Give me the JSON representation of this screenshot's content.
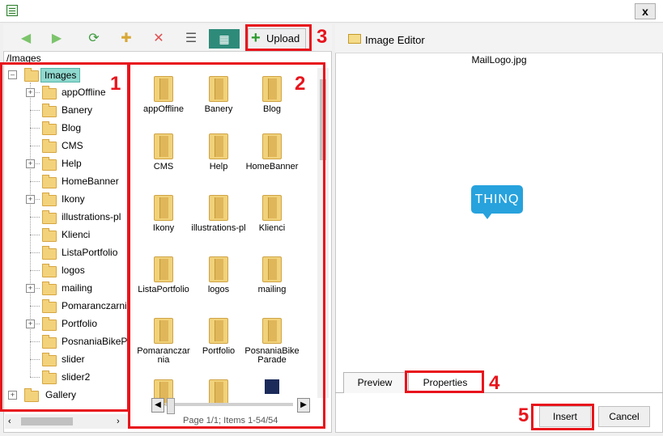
{
  "window": {
    "close_label": "x"
  },
  "toolbar": {
    "back_icon": "arrow-left-icon",
    "forward_icon": "arrow-right-icon",
    "refresh_icon": "refresh-icon",
    "new_folder_icon": "new-folder-icon",
    "delete_icon": "delete-icon",
    "list_view_icon": "list-view-icon",
    "thumb_view_icon": "thumbnail-view-icon",
    "upload_label": "Upload"
  },
  "path": "/Images",
  "tree": {
    "root": "Images",
    "items": [
      {
        "label": "appOffline",
        "expandable": true
      },
      {
        "label": "Banery",
        "expandable": false
      },
      {
        "label": "Blog",
        "expandable": false
      },
      {
        "label": "CMS",
        "expandable": false
      },
      {
        "label": "Help",
        "expandable": true
      },
      {
        "label": "HomeBanner",
        "expandable": false
      },
      {
        "label": "Ikony",
        "expandable": true
      },
      {
        "label": "illustrations-pl",
        "expandable": false
      },
      {
        "label": "Klienci",
        "expandable": false
      },
      {
        "label": "ListaPortfolio",
        "expandable": false
      },
      {
        "label": "logos",
        "expandable": false
      },
      {
        "label": "mailing",
        "expandable": true
      },
      {
        "label": "Pomaranczarnia",
        "expandable": false
      },
      {
        "label": "Portfolio",
        "expandable": true
      },
      {
        "label": "PosnaniaBikePa",
        "expandable": false
      },
      {
        "label": "slider",
        "expandable": false
      },
      {
        "label": "slider2",
        "expandable": false
      }
    ],
    "sibling": "Gallery"
  },
  "grid": {
    "items": [
      "appOffline",
      "Banery",
      "Blog",
      "CMS",
      "Help",
      "HomeBanner",
      "Ikony",
      "illustrations-pl",
      "Klienci",
      "ListaPortfolio",
      "logos",
      "mailing",
      "Pomaranczarnia",
      "Portfolio",
      "PosnaniaBikeParade"
    ],
    "page_info": "Page 1/1; Items 1-54/54"
  },
  "editor": {
    "title": "Image Editor",
    "file_name": "MailLogo.jpg",
    "logo_text": "THINQ",
    "logo_color": "#27a2dd",
    "tab_preview": "Preview",
    "tab_properties": "Properties",
    "insert_label": "Insert",
    "cancel_label": "Cancel"
  },
  "annotations": [
    "1",
    "2",
    "3",
    "4",
    "5"
  ],
  "annotation_color": "#e8141c"
}
